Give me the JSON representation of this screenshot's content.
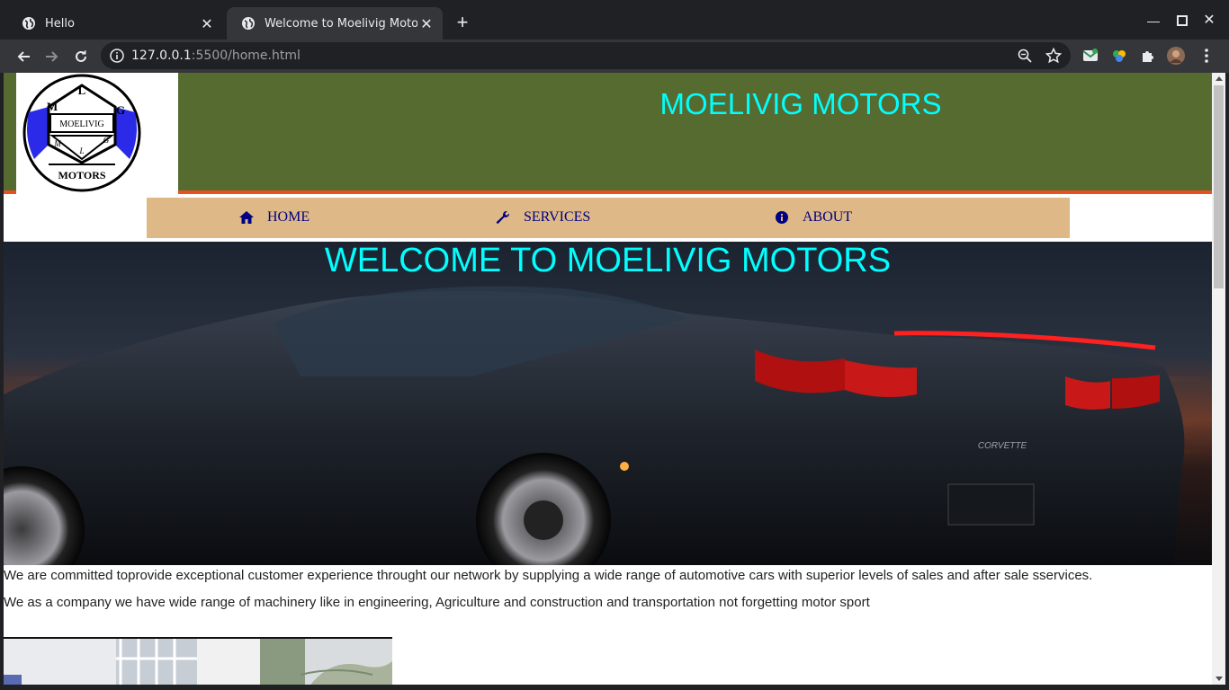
{
  "browser": {
    "tabs": [
      {
        "title": "Hello",
        "active": false
      },
      {
        "title": "Welcome to Moelivig Motors",
        "active": true
      }
    ],
    "url_host": "127.0.0.1",
    "url_rest": ":5500/home.html"
  },
  "page": {
    "site_title": "MOELIVIG MOTORS",
    "logo": {
      "top": "L",
      "left": "M",
      "right": "G",
      "middle": "MOELIVIG",
      "small_left": "M",
      "small_mid": "L",
      "small_right": "G",
      "bottom": "MOTORS"
    },
    "nav": [
      {
        "label": "HOME",
        "icon": "home-icon"
      },
      {
        "label": "SERVICES",
        "icon": "wrench-icon"
      },
      {
        "label": "ABOUT",
        "icon": "info-icon"
      }
    ],
    "hero_title": "WELCOME TO MOELIVIG MOTORS",
    "paragraphs": [
      "We are committed toprovide exceptional customer experience throught our network by supplying a wide range of automotive cars with superior levels of sales and after sale sservices.",
      "We as a company we have wide range of machinery like in engineering, Agriculture and construction and transportation not forgetting motor sport"
    ],
    "colors": {
      "header_bg": "#556b2f",
      "header_border": "#e8501f",
      "title": "#00ffff",
      "nav_bg": "#deb887",
      "nav_text": "#000080"
    }
  }
}
